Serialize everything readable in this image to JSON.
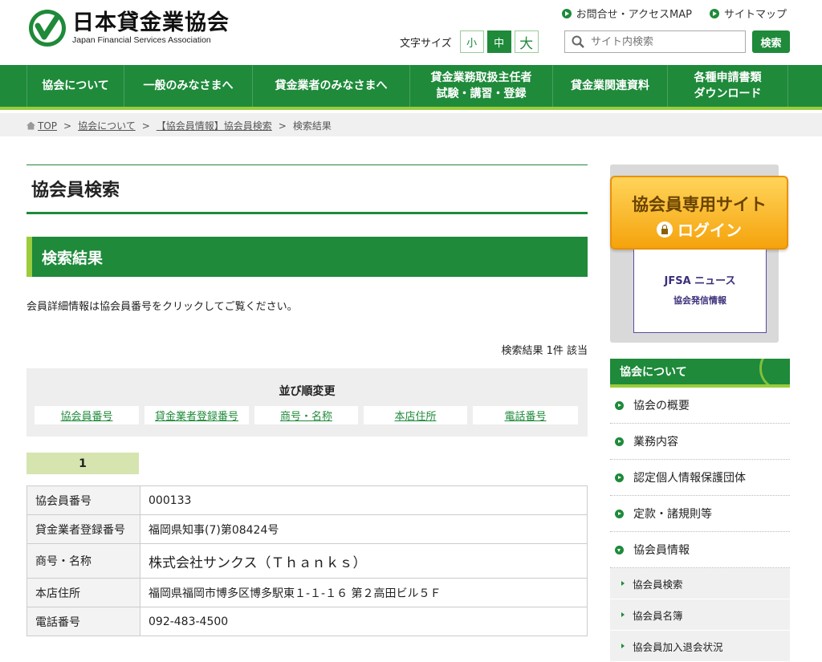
{
  "header": {
    "logo_jp": "日本貸金業協会",
    "logo_en": "Japan Financial Services Association",
    "top_links": [
      "お問合せ・アクセスMAP",
      "サイトマップ"
    ],
    "fontsize_label": "文字サイズ",
    "fontsize_small": "小",
    "fontsize_medium": "中",
    "fontsize_large": "大",
    "search_placeholder": "サイト内検索",
    "search_button": "検索"
  },
  "nav": [
    {
      "label": "協会について"
    },
    {
      "label": "一般のみなさまへ"
    },
    {
      "label": "貸金業者のみなさまへ"
    },
    {
      "label": "貸金業務取扱主任者\n試験・講習・登録"
    },
    {
      "label": "貸金業関連資料"
    },
    {
      "label": "各種申請書類\nダウンロード"
    }
  ],
  "breadcrumb": [
    "TOP",
    "協会について",
    "【協会員情報】協会員検索",
    "検索結果"
  ],
  "main": {
    "page_title": "協会員検索",
    "section_title": "検索結果",
    "intro": "会員詳細情報は協会員番号をクリックしてご覧ください。",
    "result_count": "検索結果 1件 該当",
    "sort_title": "並び順変更",
    "sort_links": [
      "協会員番号",
      "貸金業者登録番号",
      "商号・名称",
      "本店住所",
      "電話番号"
    ],
    "result_number": "1",
    "detail": [
      {
        "key": "協会員番号",
        "value": "000133"
      },
      {
        "key": "貸金業者登録番号",
        "value": "福岡県知事(7)第08424号"
      },
      {
        "key": "商号・名称",
        "value": "株式会社サンクス（Ｔｈａｎｋｓ）"
      },
      {
        "key": "本店住所",
        "value": "福岡県福岡市博多区博多駅東１-１-１６ 第２高田ビル５Ｆ"
      },
      {
        "key": "電話番号",
        "value": "092-483-4500"
      }
    ]
  },
  "sidebar": {
    "banner_line1": "協会員専用サイト",
    "banner_line2": "ログイン",
    "news_line1": "JFSA ニュース",
    "news_line2": "協会発信情報",
    "section_head": "協会について",
    "items": [
      "協会の概要",
      "業務内容",
      "認定個人情報保護団体",
      "定款・諸規則等",
      "協会員情報"
    ],
    "sub_items": [
      "協会員検索",
      "協会員名簿",
      "協会員加入退会状況"
    ]
  },
  "colors": {
    "brand_green": "#1e8a3a",
    "accent_lime": "#9acc3c",
    "banner_orange": "#f5a30c"
  }
}
